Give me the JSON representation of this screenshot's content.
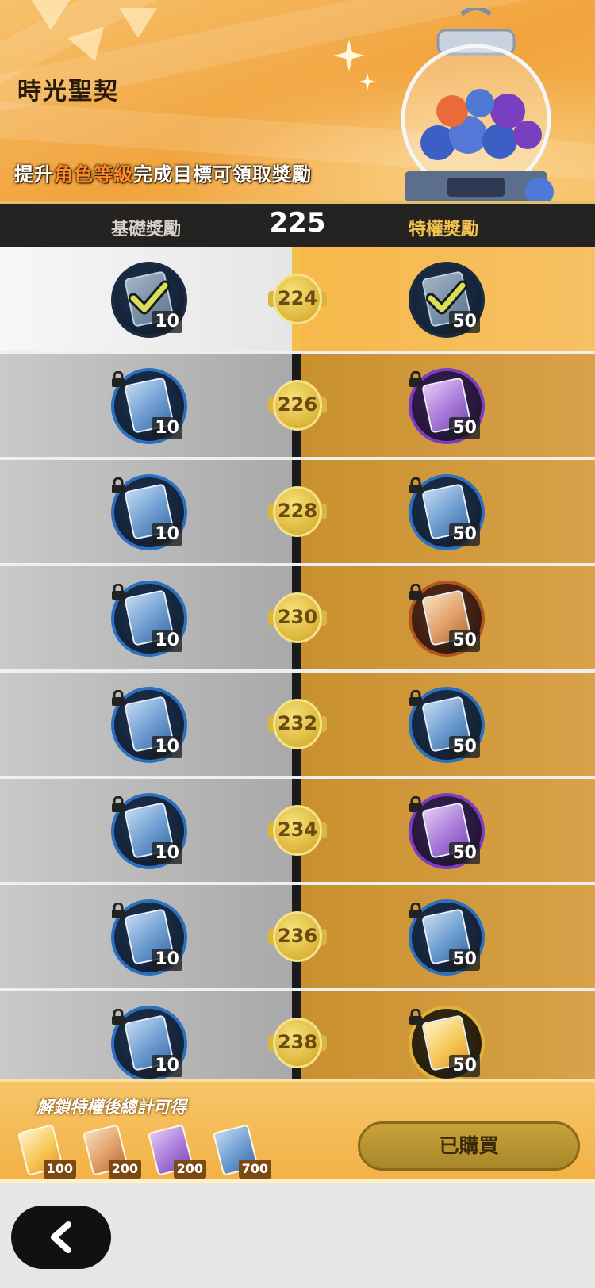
{
  "header": {
    "title": "時光聖契",
    "subtitle_pre": "提升",
    "subtitle_highlight": "角色等級",
    "subtitle_post": "完成目標可領取獎勵"
  },
  "tabbar": {
    "basic_label": "基礎獎勵",
    "current_level": "225",
    "premium_label": "特權獎勵"
  },
  "rows": [
    {
      "level": "224",
      "state": "claimed",
      "basic_qty": "10",
      "premium_qty": "50"
    },
    {
      "level": "226",
      "state": "locked",
      "basic_qty": "10",
      "premium_qty": "50"
    },
    {
      "level": "228",
      "state": "locked",
      "basic_qty": "10",
      "premium_qty": "50"
    },
    {
      "level": "230",
      "state": "locked",
      "basic_qty": "10",
      "premium_qty": "50"
    },
    {
      "level": "232",
      "state": "locked",
      "basic_qty": "10",
      "premium_qty": "50"
    },
    {
      "level": "234",
      "state": "locked",
      "basic_qty": "10",
      "premium_qty": "50"
    },
    {
      "level": "236",
      "state": "locked",
      "basic_qty": "10",
      "premium_qty": "50"
    },
    {
      "level": "238",
      "state": "locked",
      "basic_qty": "10",
      "premium_qty": "50"
    }
  ],
  "summary": {
    "title": "解鎖特權後總計可得",
    "items": [
      {
        "icon": "gold-card-icon",
        "qty": "100"
      },
      {
        "icon": "bronze-card-icon",
        "qty": "200"
      },
      {
        "icon": "purple-card-icon",
        "qty": "200"
      },
      {
        "icon": "blue-card-icon",
        "qty": "700"
      }
    ],
    "button_label": "已購買"
  },
  "colors": {
    "banner": "#f1a33d",
    "premium_accent": "#f4c24e",
    "basic_card": "#6d9cd0",
    "purple_card": "#a97ad8",
    "bronze_card": "#e0a06a",
    "gold_card": "#f6c95a"
  }
}
